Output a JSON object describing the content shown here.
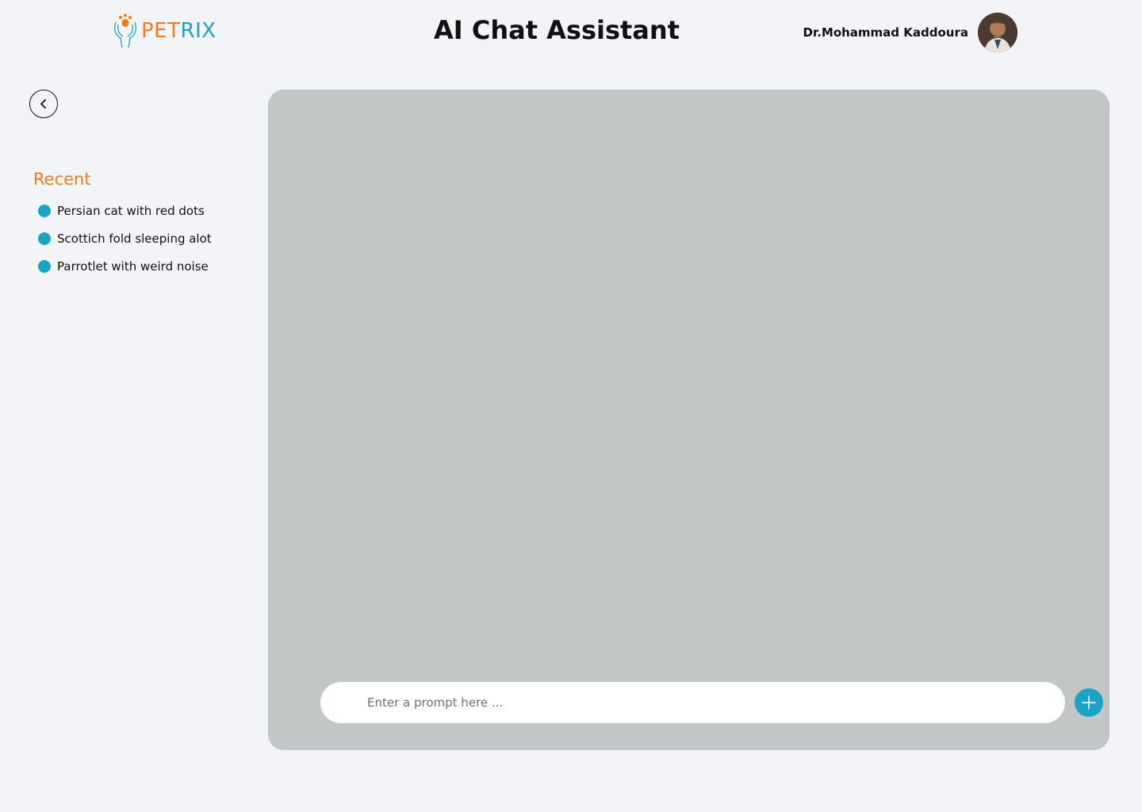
{
  "brand": {
    "name_part1": "PET",
    "name_part2": "RIX",
    "orange": "#f07b1f",
    "teal": "#1aa3c4",
    "icon": "paw-hands-icon"
  },
  "header": {
    "title": "AI Chat Assistant",
    "user_name": "Dr.Mohammad Kaddoura",
    "avatar_icon": "user-avatar"
  },
  "sidebar": {
    "back_icon": "chevron-left-icon",
    "recent_heading": "Recent",
    "items": [
      {
        "label": "Persian cat with red dots"
      },
      {
        "label": "Scottich fold sleeping alot"
      },
      {
        "label": "Parrotlet with weird noise"
      }
    ]
  },
  "chat": {
    "panel_color": "#c2c6c7",
    "prompt_placeholder": "Enter a prompt here ...",
    "prompt_value": "",
    "send_icon": "plus-icon"
  }
}
